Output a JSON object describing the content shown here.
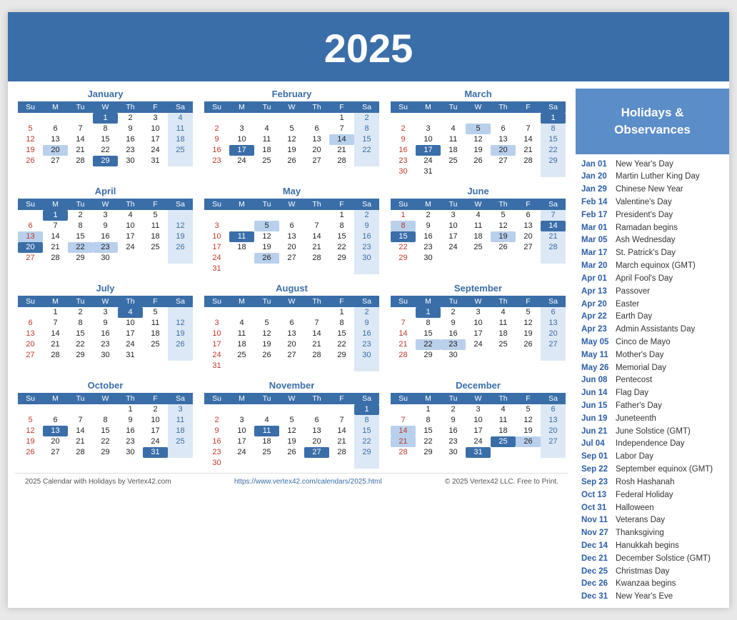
{
  "year": "2025",
  "header": {
    "title": "2025"
  },
  "holidaysHeader": "Holidays &\nObservances",
  "holidays": [
    {
      "date": "Jan 01",
      "name": "New Year's Day"
    },
    {
      "date": "Jan 20",
      "name": "Martin Luther King Day"
    },
    {
      "date": "Jan 29",
      "name": "Chinese New Year"
    },
    {
      "date": "Feb 14",
      "name": "Valentine's Day"
    },
    {
      "date": "Feb 17",
      "name": "President's Day"
    },
    {
      "date": "Mar 01",
      "name": "Ramadan begins"
    },
    {
      "date": "Mar 05",
      "name": "Ash Wednesday"
    },
    {
      "date": "Mar 17",
      "name": "St. Patrick's Day"
    },
    {
      "date": "Mar 20",
      "name": "March equinox (GMT)"
    },
    {
      "date": "Apr 01",
      "name": "April Fool's Day"
    },
    {
      "date": "Apr 13",
      "name": "Passover"
    },
    {
      "date": "Apr 20",
      "name": "Easter"
    },
    {
      "date": "Apr 22",
      "name": "Earth Day"
    },
    {
      "date": "Apr 23",
      "name": "Admin Assistants Day"
    },
    {
      "date": "May 05",
      "name": "Cinco de Mayo"
    },
    {
      "date": "May 11",
      "name": "Mother's Day"
    },
    {
      "date": "May 26",
      "name": "Memorial Day"
    },
    {
      "date": "Jun 08",
      "name": "Pentecost"
    },
    {
      "date": "Jun 14",
      "name": "Flag Day"
    },
    {
      "date": "Jun 15",
      "name": "Father's Day"
    },
    {
      "date": "Jun 19",
      "name": "Juneteenth"
    },
    {
      "date": "Jun 21",
      "name": "June Solstice (GMT)"
    },
    {
      "date": "Jul 04",
      "name": "Independence Day"
    },
    {
      "date": "Sep 01",
      "name": "Labor Day"
    },
    {
      "date": "Sep 22",
      "name": "September equinox (GMT)"
    },
    {
      "date": "Sep 23",
      "name": "Rosh Hashanah"
    },
    {
      "date": "Oct 13",
      "name": "Federal Holiday"
    },
    {
      "date": "Oct 31",
      "name": "Halloween"
    },
    {
      "date": "Nov 11",
      "name": "Veterans Day"
    },
    {
      "date": "Nov 27",
      "name": "Thanksgiving"
    },
    {
      "date": "Dec 14",
      "name": "Hanukkah begins"
    },
    {
      "date": "Dec 21",
      "name": "December Solstice (GMT)"
    },
    {
      "date": "Dec 25",
      "name": "Christmas Day"
    },
    {
      "date": "Dec 26",
      "name": "Kwanzaa begins"
    },
    {
      "date": "Dec 31",
      "name": "New Year's Eve"
    }
  ],
  "footer": {
    "left": "2025 Calendar with Holidays by Vertex42.com",
    "center": "https://www.vertex42.com/calendars/2025.html",
    "right": "© 2025 Vertex42 LLC. Free to Print."
  }
}
